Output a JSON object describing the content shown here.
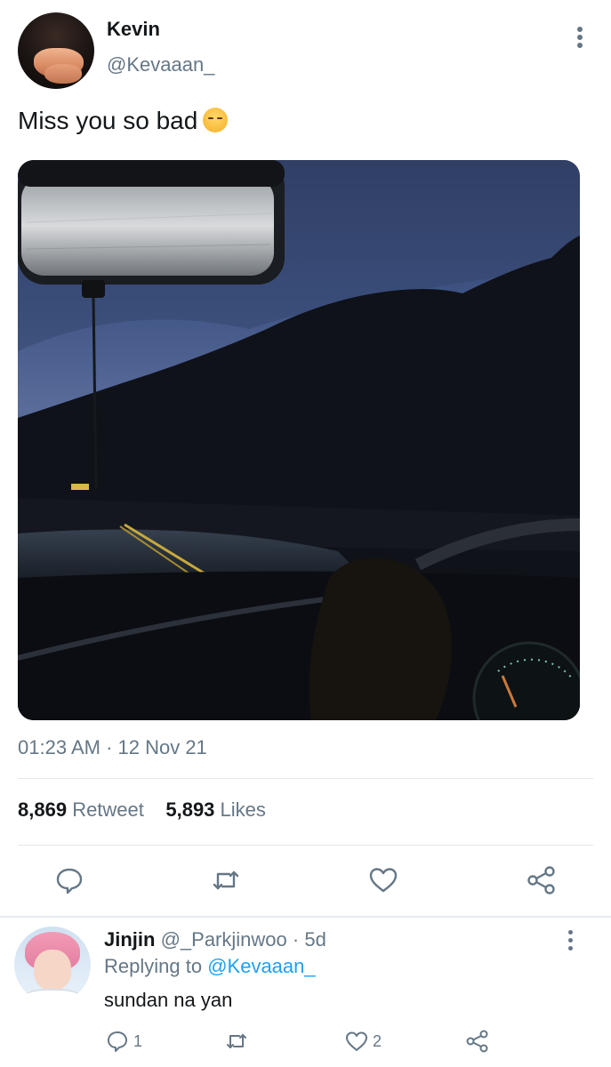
{
  "tweet": {
    "author_name": "Kevin",
    "author_handle": "@Kevaaan_",
    "text": "Miss you so bad",
    "timestamp": "01:23 AM · 12 Nov 21",
    "stats": {
      "retweets_count": "8,869",
      "retweets_label": "Retweet",
      "likes_count": "5,893",
      "likes_label": "Likes"
    },
    "icons": [
      "reply-icon",
      "retweet-icon",
      "like-icon",
      "share-icon",
      "more-icon"
    ]
  },
  "reply": {
    "author_name": "Jinjin",
    "author_handle": "@_Parkjinwoo",
    "time": "· 5d",
    "replying_label": "Replying to",
    "replying_handle": "@Kevaaan_",
    "text": "sundan na yan",
    "reply_count": "1",
    "like_count": "2"
  },
  "colors": {
    "text_primary": "#14171a",
    "text_secondary": "#657786",
    "link": "#1da1f2",
    "divider": "#e1e8ed"
  }
}
